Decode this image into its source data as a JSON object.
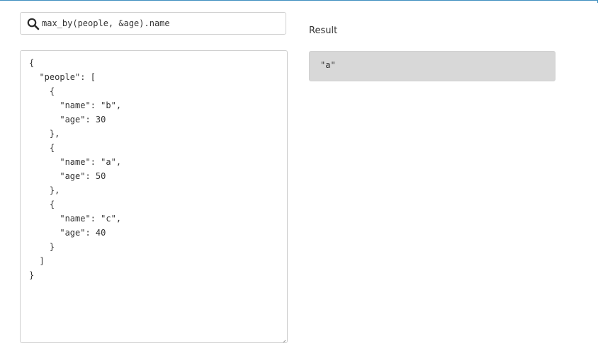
{
  "search": {
    "icon": "search-icon",
    "query": "max_by(people, &age).name"
  },
  "editor": {
    "json_text": "{\n  \"people\": [\n    {\n      \"name\": \"b\",\n      \"age\": 30\n    },\n    {\n      \"name\": \"a\",\n      \"age\": 50\n    },\n    {\n      \"name\": \"c\",\n      \"age\": 40\n    }\n  ]\n}"
  },
  "result": {
    "label": "Result",
    "value": "\"a\""
  },
  "colors": {
    "accent_border": "#3f8fbf",
    "result_background": "#d8d8d8",
    "input_border": "#cfcfcf",
    "text": "#333333"
  }
}
